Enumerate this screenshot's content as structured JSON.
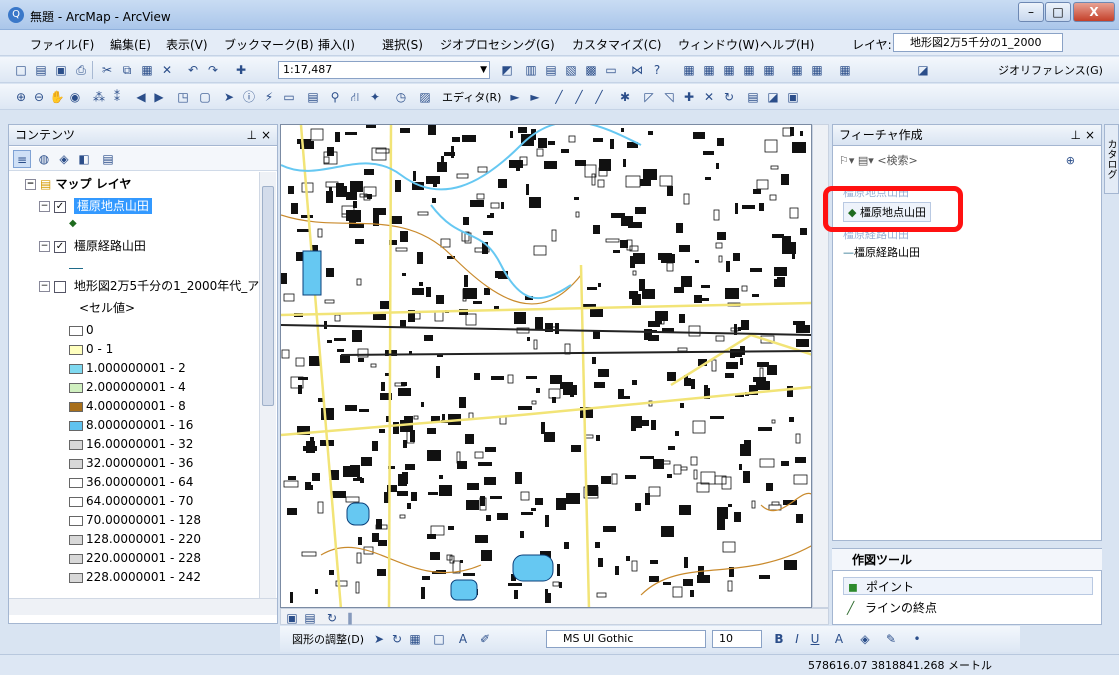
{
  "window": {
    "title": "無題 - ArcMap - ArcView",
    "app_icon": "Q",
    "min": "–",
    "max": "□",
    "close": "X"
  },
  "menu": [
    "ファイル(F)",
    "編集(E)",
    "表示(V)",
    "ブックマーク(B)",
    "挿入(I)",
    "選択(S)",
    "ジオプロセシング(G)",
    "カスタマイズ(C)",
    "ウィンドウ(W)",
    "ヘルプ(H)"
  ],
  "toolbar": {
    "layer_label": "レイヤ:",
    "layer_value": "地形図2万5千分の1_2000",
    "scale": "1:17,487",
    "georef_label": "ジオリファレンス(G)",
    "editor_label": "エディタ(R)"
  },
  "toc": {
    "title": "コンテンツ",
    "map_layer": "マップ レイヤ",
    "layers": [
      {
        "name": "橿原地点山田",
        "checked": true,
        "expanded": true
      },
      {
        "name": "橿原経路山田",
        "checked": true,
        "expanded": true
      },
      {
        "name": "地形図2万5千分の1_2000年代_ア",
        "checked": false,
        "expanded": true
      }
    ],
    "cell_value": "<セル値>",
    "classes": [
      {
        "label": "0",
        "color": "#ffffff"
      },
      {
        "label": "0 - 1",
        "color": "#ffffbe"
      },
      {
        "label": "1.000000001 - 2",
        "color": "#7fd9f0"
      },
      {
        "label": "2.000000001 - 4",
        "color": "#d0f0c0"
      },
      {
        "label": "4.000000001 - 8",
        "color": "#a86f1a"
      },
      {
        "label": "8.000000001 - 16",
        "color": "#5fc3f0"
      },
      {
        "label": "16.00000001 - 32",
        "color": "#d8d8d8"
      },
      {
        "label": "32.00000001 - 36",
        "color": "#d8d8d8"
      },
      {
        "label": "36.00000001 - 64",
        "color": "#ffffff"
      },
      {
        "label": "64.00000001 - 70",
        "color": "#ffffff"
      },
      {
        "label": "70.00000001 - 128",
        "color": "#ffffff"
      },
      {
        "label": "128.0000001 - 220",
        "color": "#d8d8d8"
      },
      {
        "label": "220.0000001 - 228",
        "color": "#d8d8d8"
      },
      {
        "label": "228.0000001 - 242",
        "color": "#d8d8d8"
      }
    ]
  },
  "feature_template": {
    "title": "フィーチャ作成",
    "search": "<検索>",
    "group1": "橿原地点山田",
    "item1": "橿原地点山田",
    "group2": "橿原経路山田",
    "item2": "橿原経路山田"
  },
  "construction_tools": {
    "title": "作図ツール",
    "items": [
      "ポイント",
      "ラインの終点"
    ]
  },
  "catalog_tab": "カタログ",
  "drawbar": {
    "drawing_label": "図形の調整(D)",
    "font": "MS UI Gothic",
    "size": "10"
  },
  "status": {
    "coords": "578616.07  3818841.268 メートル"
  },
  "colors": {
    "highlight": "#ff1111",
    "selected_bg": "#3399ff",
    "road": "#f2e477",
    "water": "#66c8f2",
    "contour": "#c98a2c"
  }
}
